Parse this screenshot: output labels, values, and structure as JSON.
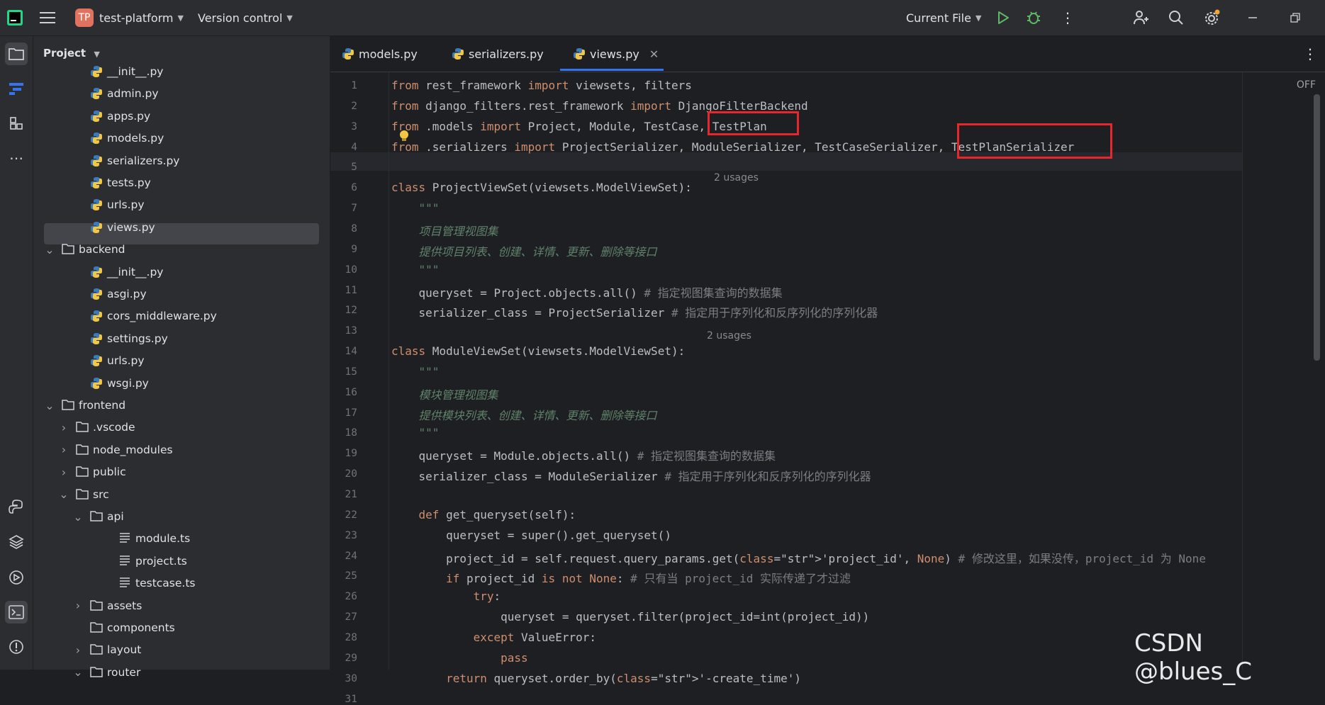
{
  "titlebar": {
    "project_badge": "TP",
    "project_name": "test-platform",
    "vcs": "Version control",
    "run_config": "Current File"
  },
  "sidebar_header": {
    "title": "Project"
  },
  "tree": [
    {
      "label": "__init__.py",
      "indent": 3,
      "type": "py"
    },
    {
      "label": "admin.py",
      "indent": 3,
      "type": "py"
    },
    {
      "label": "apps.py",
      "indent": 3,
      "type": "py"
    },
    {
      "label": "models.py",
      "indent": 3,
      "type": "py"
    },
    {
      "label": "serializers.py",
      "indent": 3,
      "type": "py"
    },
    {
      "label": "tests.py",
      "indent": 3,
      "type": "py"
    },
    {
      "label": "urls.py",
      "indent": 3,
      "type": "py"
    },
    {
      "label": "views.py",
      "indent": 3,
      "type": "py",
      "selected": true
    },
    {
      "label": "backend",
      "indent": 1,
      "type": "folder",
      "expanded": true
    },
    {
      "label": "__init__.py",
      "indent": 3,
      "type": "py"
    },
    {
      "label": "asgi.py",
      "indent": 3,
      "type": "py"
    },
    {
      "label": "cors_middleware.py",
      "indent": 3,
      "type": "py"
    },
    {
      "label": "settings.py",
      "indent": 3,
      "type": "py"
    },
    {
      "label": "urls.py",
      "indent": 3,
      "type": "py"
    },
    {
      "label": "wsgi.py",
      "indent": 3,
      "type": "py"
    },
    {
      "label": "frontend",
      "indent": 1,
      "type": "folder",
      "expanded": true
    },
    {
      "label": ".vscode",
      "indent": 2,
      "type": "folder",
      "expanded": false
    },
    {
      "label": "node_modules",
      "indent": 2,
      "type": "folder",
      "expanded": false
    },
    {
      "label": "public",
      "indent": 2,
      "type": "folder",
      "expanded": false
    },
    {
      "label": "src",
      "indent": 2,
      "type": "folder",
      "expanded": true
    },
    {
      "label": "api",
      "indent": 3,
      "type": "folder",
      "expanded": true
    },
    {
      "label": "module.ts",
      "indent": 5,
      "type": "ts"
    },
    {
      "label": "project.ts",
      "indent": 5,
      "type": "ts"
    },
    {
      "label": "testcase.ts",
      "indent": 5,
      "type": "ts"
    },
    {
      "label": "assets",
      "indent": 3,
      "type": "folder",
      "expanded": false
    },
    {
      "label": "components",
      "indent": 3,
      "type": "folder",
      "leaf": true
    },
    {
      "label": "layout",
      "indent": 3,
      "type": "folder",
      "expanded": false
    },
    {
      "label": "router",
      "indent": 3,
      "type": "folder",
      "expanded": true
    }
  ],
  "tabs": [
    {
      "label": "models.py"
    },
    {
      "label": "serializers.py"
    },
    {
      "label": "views.py",
      "active": true
    }
  ],
  "editor": {
    "readmode": "OFF",
    "line_numbers": [
      "1",
      "2",
      "3",
      "4",
      "5",
      "6",
      "7",
      "8",
      "9",
      "10",
      "11",
      "12",
      "13",
      "14",
      "15",
      "16",
      "17",
      "18",
      "19",
      "20",
      "21",
      "22",
      "23",
      "24",
      "25",
      "26",
      "27",
      "28",
      "29",
      "30",
      "31"
    ],
    "lines": [
      "from rest_framework import viewsets, filters",
      "from django_filters.rest_framework import DjangoFilterBackend",
      "from .models import Project, Module, TestCase, TestPlan",
      "from .serializers import ProjectSerializer, ModuleSerializer, TestCaseSerializer, TestPlanSerializer",
      "",
      "class ProjectViewSet(viewsets.ModelViewSet):",
      "    \"\"\"",
      "    项目管理视图集",
      "    提供项目列表、创建、详情、更新、删除等接口",
      "    \"\"\"",
      "    queryset = Project.objects.all() # 指定视图集查询的数据集",
      "    serializer_class = ProjectSerializer # 指定用于序列化和反序列化的序列化器",
      "",
      "class ModuleViewSet(viewsets.ModelViewSet):",
      "    \"\"\"",
      "    模块管理视图集",
      "    提供模块列表、创建、详情、更新、删除等接口",
      "    \"\"\"",
      "    queryset = Module.objects.all() # 指定视图集查询的数据集",
      "    serializer_class = ModuleSerializer # 指定用于序列化和反序列化的序列化器",
      "",
      "    def get_queryset(self):",
      "        queryset = super().get_queryset()",
      "        project_id = self.request.query_params.get('project_id', None) # 修改这里，如果没传，project_id 为 None",
      "        if project_id is not None: # 只有当 project_id 实际传递了才过滤",
      "            try:",
      "                queryset = queryset.filter(project_id=int(project_id))",
      "            except ValueError:",
      "                pass",
      "        return queryset.order_by('-create_time')",
      ""
    ],
    "usages": [
      "2 usages",
      "2 usages"
    ]
  },
  "watermark": "CSDN @blues_C",
  "colors": {
    "accent": "#3574f0",
    "highlight_box": "#e8262b",
    "run": "#5fb865"
  }
}
